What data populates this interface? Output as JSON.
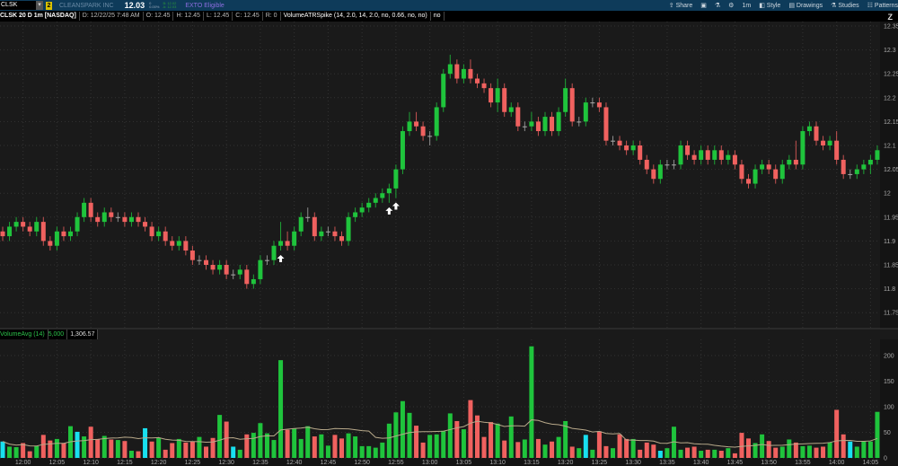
{
  "topbar": {
    "symbol": "CLSK",
    "company": "CLEANSPARK INC",
    "last": "12.03",
    "change": "0",
    "change_pct": "0.00%",
    "bid": "B: 12.02",
    "ask": "A: 12.03",
    "badge": "EXTO Eligible",
    "link_num": "2"
  },
  "tools": {
    "share": "Share",
    "style": "Style",
    "drawings": "Drawings",
    "studies": "Studies",
    "patterns": "Patterns",
    "interval": "1m"
  },
  "header": {
    "title": "CLSK 20 D 1m [NASDAQ]",
    "date": "D: 12/22/25 7:48 AM",
    "open": "O: 12.45",
    "high": "H: 12.45",
    "low": "L: 12.45",
    "close": "C: 12.45",
    "range": "R: 0",
    "study": "VolumeATRSpike (14, 2.0, 14, 2.0, no, 0.66, no, no)",
    "study_flag": "no"
  },
  "volume_header": {
    "study": "VolumeAvg (14)",
    "value": "5,000",
    "avg": "1,306.57"
  },
  "colors": {
    "up": "#1fc43c",
    "down": "#f0615f",
    "spike": "#18e0f0",
    "avg_line": "#b8a98a",
    "background": "#1a1a1a",
    "topbar": "#0e3b5a"
  },
  "chart_data": [
    {
      "type": "candlestick",
      "ylim": [
        11.73,
        12.36
      ],
      "y_ticks": [
        "12.35",
        "12.3",
        "12.25",
        "12.2",
        "12.15",
        "12.1",
        "12.05",
        "12",
        "11.95",
        "11.9",
        "11.85",
        "11.8",
        "11.75"
      ],
      "x_ticks": [
        "12:00",
        "12:05",
        "12:10",
        "12:15",
        "12:20",
        "12:25",
        "12:30",
        "12:35",
        "12:40",
        "12:45",
        "12:50",
        "12:55",
        "13:00",
        "13:05",
        "13:10",
        "13:15",
        "13:20",
        "13:25",
        "13:30",
        "13:35",
        "13:40",
        "13:45",
        "13:50",
        "13:55",
        "14:00",
        "14:05"
      ],
      "first_bar_time": "11:57",
      "signal_arrow_bars": [
        41,
        57,
        58
      ],
      "ohlc": [
        [
          11.92,
          11.93,
          11.9,
          11.91
        ],
        [
          11.91,
          11.94,
          11.9,
          11.93
        ],
        [
          11.93,
          11.95,
          11.92,
          11.94
        ],
        [
          11.94,
          11.95,
          11.92,
          11.93
        ],
        [
          11.93,
          11.94,
          11.91,
          11.92
        ],
        [
          11.92,
          11.95,
          11.91,
          11.94
        ],
        [
          11.94,
          11.95,
          11.89,
          11.9
        ],
        [
          11.9,
          11.91,
          11.88,
          11.89
        ],
        [
          11.89,
          11.93,
          11.88,
          11.92
        ],
        [
          11.92,
          11.93,
          11.9,
          11.91
        ],
        [
          11.91,
          11.93,
          11.9,
          11.92
        ],
        [
          11.92,
          11.96,
          11.91,
          11.95
        ],
        [
          11.95,
          11.99,
          11.94,
          11.98
        ],
        [
          11.98,
          11.99,
          11.94,
          11.95
        ],
        [
          11.95,
          11.96,
          11.93,
          11.94
        ],
        [
          11.94,
          11.97,
          11.93,
          11.96
        ],
        [
          11.96,
          11.97,
          11.94,
          11.95
        ],
        [
          11.95,
          11.96,
          11.94,
          11.95
        ],
        [
          11.95,
          11.96,
          11.93,
          11.94
        ],
        [
          11.94,
          11.96,
          11.93,
          11.95
        ],
        [
          11.95,
          11.96,
          11.93,
          11.94
        ],
        [
          11.94,
          11.95,
          11.92,
          11.93
        ],
        [
          11.93,
          11.94,
          11.9,
          11.91
        ],
        [
          11.91,
          11.93,
          11.9,
          11.92
        ],
        [
          11.92,
          11.93,
          11.89,
          11.9
        ],
        [
          11.9,
          11.91,
          11.88,
          11.89
        ],
        [
          11.89,
          11.91,
          11.88,
          11.9
        ],
        [
          11.9,
          11.91,
          11.87,
          11.88
        ],
        [
          11.88,
          11.89,
          11.85,
          11.86
        ],
        [
          11.86,
          11.87,
          11.85,
          11.86
        ],
        [
          11.86,
          11.87,
          11.84,
          11.85
        ],
        [
          11.85,
          11.86,
          11.83,
          11.84
        ],
        [
          11.84,
          11.86,
          11.83,
          11.85
        ],
        [
          11.85,
          11.86,
          11.82,
          11.83
        ],
        [
          11.83,
          11.84,
          11.82,
          11.83
        ],
        [
          11.83,
          11.85,
          11.82,
          11.84
        ],
        [
          11.84,
          11.85,
          11.8,
          11.81
        ],
        [
          11.81,
          11.83,
          11.8,
          11.82
        ],
        [
          11.82,
          11.87,
          11.81,
          11.86
        ],
        [
          11.86,
          11.87,
          11.85,
          11.86
        ],
        [
          11.86,
          11.9,
          11.85,
          11.89
        ],
        [
          11.89,
          11.94,
          11.88,
          11.9
        ],
        [
          11.9,
          11.92,
          11.88,
          11.89
        ],
        [
          11.89,
          11.93,
          11.88,
          11.92
        ],
        [
          11.92,
          11.96,
          11.91,
          11.95
        ],
        [
          11.95,
          11.97,
          11.94,
          11.95
        ],
        [
          11.95,
          11.96,
          11.9,
          11.91
        ],
        [
          11.91,
          11.93,
          11.9,
          11.92
        ],
        [
          11.92,
          11.93,
          11.91,
          11.92
        ],
        [
          11.92,
          11.93,
          11.9,
          11.91
        ],
        [
          11.91,
          11.92,
          11.89,
          11.9
        ],
        [
          11.9,
          11.96,
          11.89,
          11.95
        ],
        [
          11.95,
          11.97,
          11.94,
          11.96
        ],
        [
          11.96,
          11.98,
          11.95,
          11.97
        ],
        [
          11.97,
          11.99,
          11.96,
          11.98
        ],
        [
          11.98,
          12.0,
          11.97,
          11.99
        ],
        [
          11.99,
          12.01,
          11.98,
          12.0
        ],
        [
          12.0,
          12.02,
          11.98,
          12.01
        ],
        [
          12.01,
          12.06,
          11.99,
          12.05
        ],
        [
          12.05,
          12.14,
          12.04,
          12.13
        ],
        [
          12.13,
          12.17,
          12.12,
          12.15
        ],
        [
          12.15,
          12.17,
          12.13,
          12.14
        ],
        [
          12.14,
          12.15,
          12.11,
          12.12
        ],
        [
          12.12,
          12.13,
          12.1,
          12.12
        ],
        [
          12.12,
          12.19,
          12.11,
          12.18
        ],
        [
          12.18,
          12.26,
          12.17,
          12.25
        ],
        [
          12.25,
          12.29,
          12.24,
          12.27
        ],
        [
          12.27,
          12.28,
          12.23,
          12.24
        ],
        [
          12.24,
          12.27,
          12.23,
          12.26
        ],
        [
          12.26,
          12.28,
          12.23,
          12.24
        ],
        [
          12.24,
          12.25,
          12.22,
          12.23
        ],
        [
          12.23,
          12.24,
          12.21,
          12.22
        ],
        [
          12.22,
          12.23,
          12.18,
          12.19
        ],
        [
          12.19,
          12.24,
          12.17,
          12.22
        ],
        [
          12.22,
          12.23,
          12.16,
          12.17
        ],
        [
          12.17,
          12.19,
          12.16,
          12.18
        ],
        [
          12.18,
          12.19,
          12.13,
          12.14
        ],
        [
          12.14,
          12.15,
          12.13,
          12.14
        ],
        [
          12.14,
          12.17,
          12.13,
          12.15
        ],
        [
          12.15,
          12.16,
          12.12,
          12.13
        ],
        [
          12.13,
          12.17,
          12.12,
          12.16
        ],
        [
          12.16,
          12.17,
          12.12,
          12.13
        ],
        [
          12.13,
          12.18,
          12.12,
          12.17
        ],
        [
          12.17,
          12.24,
          12.16,
          12.22
        ],
        [
          12.22,
          12.23,
          12.14,
          12.15
        ],
        [
          12.15,
          12.16,
          12.14,
          12.15
        ],
        [
          12.15,
          12.2,
          12.14,
          12.19
        ],
        [
          12.19,
          12.2,
          12.18,
          12.19
        ],
        [
          12.19,
          12.2,
          12.17,
          12.18
        ],
        [
          12.18,
          12.19,
          12.1,
          12.11
        ],
        [
          12.11,
          12.12,
          12.1,
          12.11
        ],
        [
          12.11,
          12.12,
          12.09,
          12.1
        ],
        [
          12.1,
          12.11,
          12.08,
          12.09
        ],
        [
          12.09,
          12.11,
          12.08,
          12.1
        ],
        [
          12.1,
          12.11,
          12.06,
          12.07
        ],
        [
          12.07,
          12.08,
          12.04,
          12.05
        ],
        [
          12.05,
          12.06,
          12.02,
          12.03
        ],
        [
          12.03,
          12.07,
          12.02,
          12.06
        ],
        [
          12.06,
          12.07,
          12.05,
          12.06
        ],
        [
          12.06,
          12.07,
          12.05,
          12.06
        ],
        [
          12.06,
          12.11,
          12.05,
          12.1
        ],
        [
          12.1,
          12.11,
          12.07,
          12.08
        ],
        [
          12.08,
          12.09,
          12.06,
          12.07
        ],
        [
          12.07,
          12.1,
          12.06,
          12.09
        ],
        [
          12.09,
          12.1,
          12.06,
          12.07
        ],
        [
          12.07,
          12.1,
          12.06,
          12.09
        ],
        [
          12.09,
          12.1,
          12.06,
          12.07
        ],
        [
          12.07,
          12.09,
          12.06,
          12.08
        ],
        [
          12.08,
          12.09,
          12.05,
          12.06
        ],
        [
          12.06,
          12.07,
          12.02,
          12.03
        ],
        [
          12.03,
          12.04,
          12.01,
          12.02
        ],
        [
          12.02,
          12.06,
          12.01,
          12.05
        ],
        [
          12.05,
          12.07,
          12.04,
          12.06
        ],
        [
          12.06,
          12.07,
          12.04,
          12.05
        ],
        [
          12.05,
          12.06,
          12.02,
          12.03
        ],
        [
          12.03,
          12.07,
          12.02,
          12.06
        ],
        [
          12.06,
          12.08,
          12.05,
          12.07
        ],
        [
          12.07,
          12.11,
          12.05,
          12.06
        ],
        [
          12.06,
          12.14,
          12.05,
          12.13
        ],
        [
          12.13,
          12.15,
          12.12,
          12.14
        ],
        [
          12.14,
          12.15,
          12.1,
          12.11
        ],
        [
          12.11,
          12.12,
          12.09,
          12.1
        ],
        [
          12.1,
          12.12,
          12.09,
          12.11
        ],
        [
          12.11,
          12.13,
          12.06,
          12.07
        ],
        [
          12.07,
          12.08,
          12.03,
          12.04
        ],
        [
          12.04,
          12.05,
          12.03,
          12.04
        ],
        [
          12.04,
          12.06,
          12.03,
          12.05
        ],
        [
          12.05,
          12.07,
          12.04,
          12.06
        ],
        [
          12.06,
          12.08,
          12.04,
          12.07
        ],
        [
          12.07,
          12.1,
          12.06,
          12.09
        ]
      ]
    },
    {
      "type": "bar",
      "ylim": [
        0,
        220
      ],
      "y_ticks": [
        "200",
        "150",
        "100",
        "50",
        "0"
      ],
      "avg_period": 14,
      "spike_bars": [
        0,
        11,
        21,
        34,
        86,
        97,
        125
      ],
      "values": [
        32,
        22,
        21,
        29,
        13,
        23,
        45,
        34,
        37,
        29,
        62,
        51,
        42,
        61,
        37,
        43,
        36,
        35,
        33,
        14,
        13,
        58,
        32,
        39,
        16,
        29,
        37,
        30,
        32,
        41,
        22,
        39,
        84,
        71,
        22,
        16,
        46,
        49,
        68,
        48,
        35,
        191,
        55,
        57,
        37,
        62,
        42,
        46,
        24,
        45,
        38,
        48,
        42,
        23,
        23,
        20,
        30,
        67,
        89,
        111,
        88,
        63,
        30,
        45,
        46,
        53,
        87,
        72,
        56,
        113,
        83,
        41,
        70,
        67,
        34,
        81,
        31,
        36,
        218,
        37,
        26,
        32,
        41,
        72,
        22,
        19,
        45,
        16,
        52,
        23,
        19,
        46,
        37,
        37,
        16,
        30,
        26,
        14,
        19,
        61,
        16,
        20,
        22,
        14,
        16,
        16,
        14,
        19,
        9,
        49,
        38,
        29,
        46,
        33,
        20,
        22,
        36,
        30,
        23,
        24,
        20,
        22,
        30,
        94,
        46,
        32,
        22,
        32,
        32,
        90
      ]
    }
  ]
}
